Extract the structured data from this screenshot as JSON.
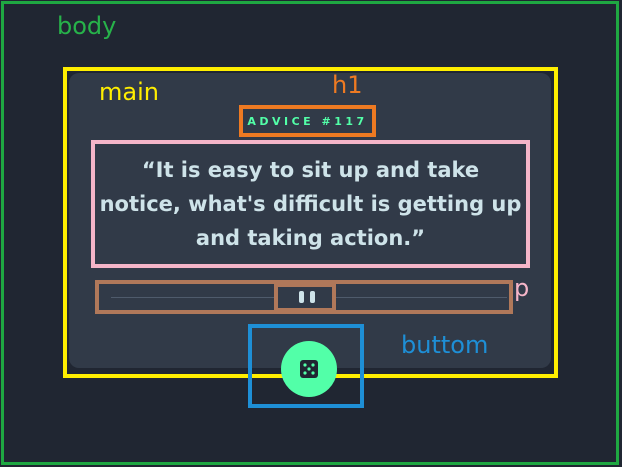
{
  "advice": {
    "heading": "ADVICE #117",
    "quote": "“It is easy to sit up and take notice, what's difficult is getting up and taking action.”"
  },
  "divider": {
    "icon": "pause-icon"
  },
  "dice_button": {
    "icon": "dice-icon"
  },
  "annotations": {
    "body": "body",
    "main": "main",
    "h1": "h1",
    "p": "p",
    "button": "buttom"
  },
  "colors": {
    "background": "#202632",
    "card": "#313a48",
    "accent": "#52ffa8",
    "text": "#cee3e9",
    "outline_body": "#1fa842",
    "outline_main": "#ffee00",
    "outline_h1": "#ee7a22",
    "outline_p": "#f5b5c8",
    "outline_divider": "#b0785a",
    "outline_button": "#1e8fd6"
  }
}
